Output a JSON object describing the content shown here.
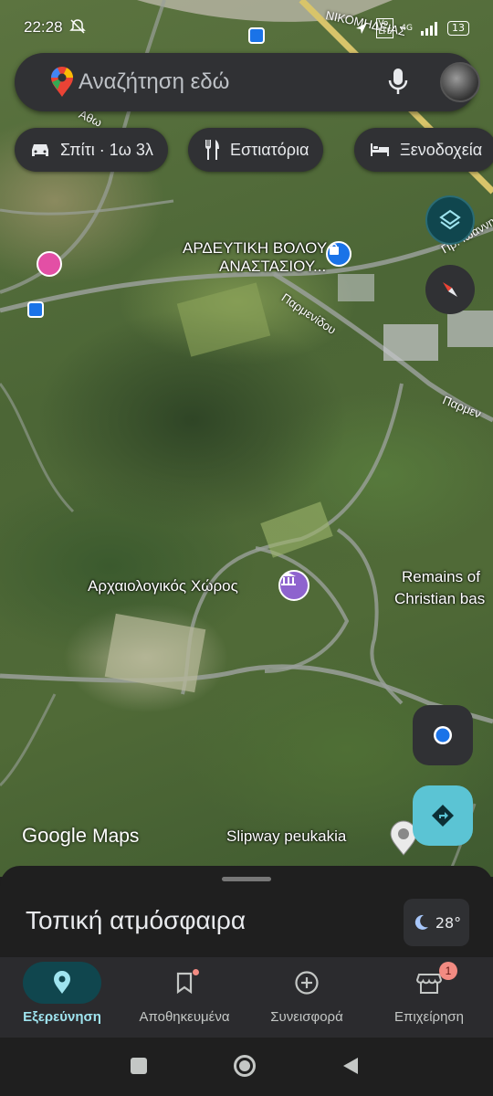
{
  "status_bar": {
    "time": "22:28",
    "network": "4G",
    "lte": "LTE",
    "battery": "13"
  },
  "search": {
    "placeholder": "Αναζήτηση εδώ"
  },
  "chips": [
    {
      "label": "Σπίτι · 1ω 3λ",
      "icon": "car-icon"
    },
    {
      "label": "Εστιατόρια",
      "icon": "fork-knife-icon"
    },
    {
      "label": "Ξενοδοχεία",
      "icon": "bed-icon"
    }
  ],
  "map": {
    "places": {
      "store_line1": "ΑΡΔΕΥΤΙΚΗ ΒΟΛΟΥ",
      "store_line2": "ΑΝΑΣΤΑΣΙΟΥ...",
      "archaeological": "Αρχαιολογικός Χώρος",
      "remains_line1": "Remains of",
      "remains_line2": "Christian bas",
      "slipway": "Slipway peukakia"
    },
    "roads": {
      "nikomideias": "ΝΙΚΟΜΗΔΕΙΑΣ",
      "parmenidou_1": "Παρμενίδου",
      "parmenidou_2": "Παρμεν",
      "top_right": "Πρ. Ιωάννη",
      "top_left": "Αθω"
    },
    "logo": {
      "google": "Google",
      "maps": "Maps"
    }
  },
  "sheet": {
    "title": "Τοπική ατμόσφαιρα"
  },
  "weather": {
    "temp": "28°"
  },
  "nav": {
    "items": [
      {
        "label": "Εξερεύνηση",
        "icon": "location-pin-icon",
        "active": true
      },
      {
        "label": "Αποθηκευμένα",
        "icon": "bookmark-icon"
      },
      {
        "label": "Συνεισφορά",
        "icon": "add-circle-icon"
      },
      {
        "label": "Επιχείρηση",
        "icon": "storefront-icon",
        "badge": "1"
      }
    ]
  },
  "colors": {
    "accent": "#10464e",
    "accent_text": "#9fe4ef",
    "badge": "#f28b82",
    "fab_directions": "#5bc4d4"
  }
}
